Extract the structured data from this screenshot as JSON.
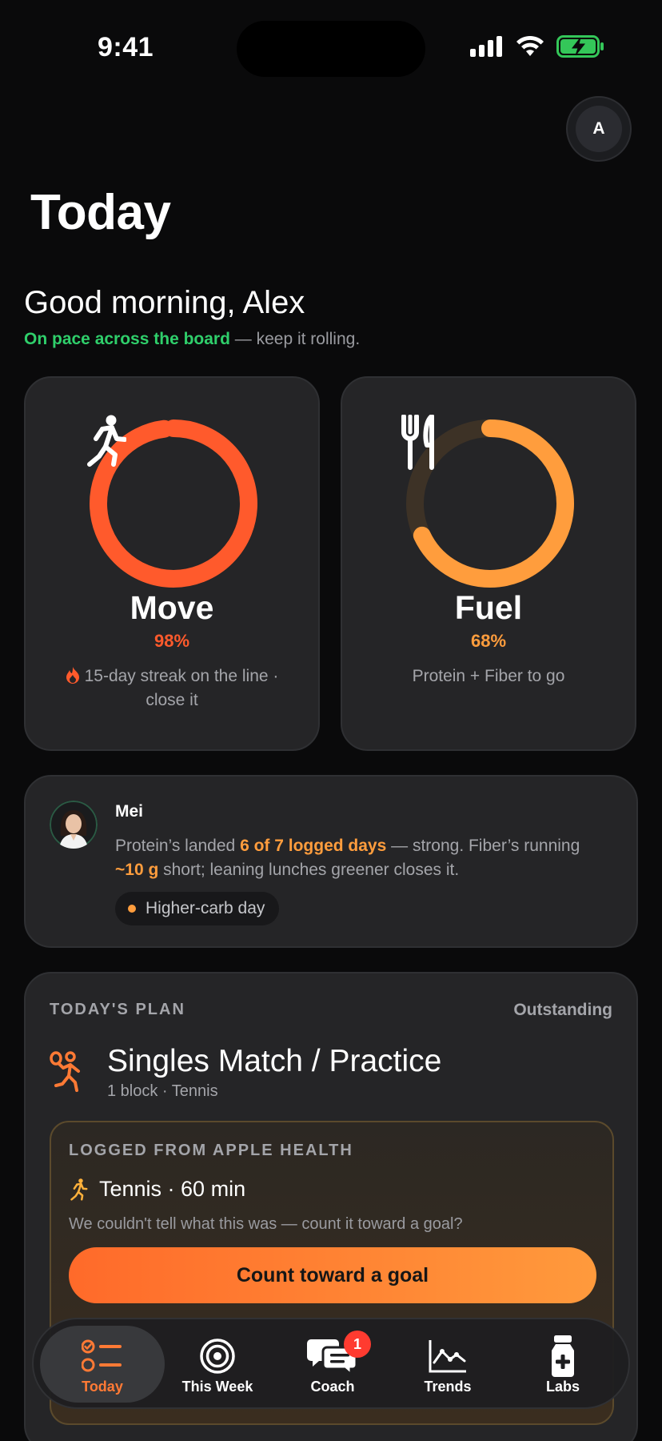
{
  "status_bar": {
    "time": "9:41"
  },
  "profile": {
    "initial": "A"
  },
  "page": {
    "title": "Today",
    "greeting": "Good morning, Alex",
    "status_highlight": "On pace across the board",
    "status_rest": " — keep it rolling."
  },
  "rings": {
    "move": {
      "label": "Move",
      "percent_text": "98%",
      "progress": 0.98,
      "color": "#ff5a2c",
      "desc": "15-day streak on the line · close it"
    },
    "fuel": {
      "label": "Fuel",
      "percent_text": "68%",
      "progress": 0.68,
      "color": "#ff9d3d",
      "desc": "Protein + Fiber to go"
    }
  },
  "coach": {
    "name": "Mei",
    "msg_part1": "Protein’s landed ",
    "msg_hl1": "6 of 7 logged days",
    "msg_part2": " — strong. Fiber’s running ",
    "msg_hl2": "~10 g",
    "msg_part3": " short; leaning lunches greener closes it.",
    "chip": "Higher-carb day"
  },
  "plan": {
    "heading": "TODAY'S PLAN",
    "status": "Outstanding",
    "title": "Singles Match / Practice",
    "meta": "1 block · Tennis",
    "health": {
      "heading": "LOGGED FROM APPLE HEALTH",
      "activity": "Tennis · 60 min",
      "question": "We couldn't tell what this was — count it toward a goal?",
      "button": "Count toward a goal"
    }
  },
  "tabs": [
    {
      "label": "Today",
      "icon": "checklist-icon",
      "active": true
    },
    {
      "label": "This Week",
      "icon": "target-icon"
    },
    {
      "label": "Coach",
      "icon": "chat-bubbles-icon",
      "badge": "1"
    },
    {
      "label": "Trends",
      "icon": "line-chart-icon"
    },
    {
      "label": "Labs",
      "icon": "medicine-bottle-icon"
    }
  ],
  "colors": {
    "accent": "#ff7a35",
    "green": "#2fcf6b",
    "orange": "#ff9d3d",
    "red": "#ff5a2c"
  }
}
